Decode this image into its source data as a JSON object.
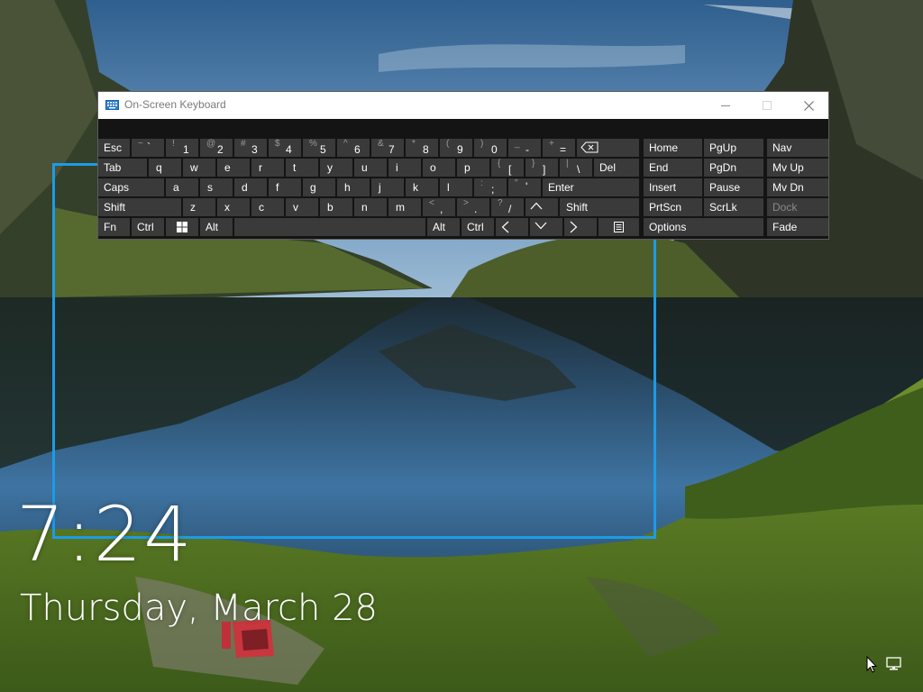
{
  "lock_screen": {
    "time": "7:24",
    "date": "Thursday, March 28"
  },
  "osk": {
    "title": "On-Screen Keyboard",
    "caption_buttons": [
      "minimize",
      "maximize",
      "close"
    ],
    "rows": [
      [
        {
          "id": "esc",
          "main": "Esc"
        },
        {
          "id": "tilde",
          "sub": "~",
          "low": "`"
        },
        {
          "id": "1",
          "sub": "!",
          "low": "1"
        },
        {
          "id": "2",
          "sub": "@",
          "low": "2"
        },
        {
          "id": "3",
          "sub": "#",
          "low": "3"
        },
        {
          "id": "4",
          "sub": "$",
          "low": "4"
        },
        {
          "id": "5",
          "sub": "%",
          "low": "5"
        },
        {
          "id": "6",
          "sub": "^",
          "low": "6"
        },
        {
          "id": "7",
          "sub": "&",
          "low": "7"
        },
        {
          "id": "8",
          "sub": "*",
          "low": "8"
        },
        {
          "id": "9",
          "sub": "(",
          "low": "9"
        },
        {
          "id": "0",
          "sub": ")",
          "low": "0"
        },
        {
          "id": "minus",
          "sub": "_",
          "low": "-"
        },
        {
          "id": "equals",
          "sub": "+",
          "low": "="
        },
        {
          "id": "backspace",
          "icon": "backspace-icon"
        }
      ],
      [
        {
          "id": "tab",
          "main": "Tab"
        },
        {
          "id": "q",
          "main": "q"
        },
        {
          "id": "w",
          "main": "w"
        },
        {
          "id": "e",
          "main": "e"
        },
        {
          "id": "r",
          "main": "r"
        },
        {
          "id": "t",
          "main": "t"
        },
        {
          "id": "y",
          "main": "y"
        },
        {
          "id": "u",
          "main": "u"
        },
        {
          "id": "i",
          "main": "i"
        },
        {
          "id": "o",
          "main": "o"
        },
        {
          "id": "p",
          "main": "p"
        },
        {
          "id": "lbracket",
          "sub": "{",
          "low": "["
        },
        {
          "id": "rbracket",
          "sub": "}",
          "low": "]"
        },
        {
          "id": "backslash",
          "sub": "|",
          "low": "\\"
        },
        {
          "id": "del",
          "main": "Del"
        }
      ],
      [
        {
          "id": "caps",
          "main": "Caps"
        },
        {
          "id": "a",
          "main": "a"
        },
        {
          "id": "s",
          "main": "s"
        },
        {
          "id": "d",
          "main": "d"
        },
        {
          "id": "f",
          "main": "f"
        },
        {
          "id": "g",
          "main": "g"
        },
        {
          "id": "h",
          "main": "h"
        },
        {
          "id": "j",
          "main": "j"
        },
        {
          "id": "k",
          "main": "k"
        },
        {
          "id": "l",
          "main": "l"
        },
        {
          "id": "semicolon",
          "sub": ":",
          "low": ";"
        },
        {
          "id": "quote",
          "sub": "\"",
          "low": "'"
        },
        {
          "id": "enter",
          "main": "Enter"
        }
      ],
      [
        {
          "id": "lshift",
          "main": "Shift"
        },
        {
          "id": "z",
          "main": "z"
        },
        {
          "id": "x",
          "main": "x"
        },
        {
          "id": "c",
          "main": "c"
        },
        {
          "id": "v",
          "main": "v"
        },
        {
          "id": "b",
          "main": "b"
        },
        {
          "id": "n",
          "main": "n"
        },
        {
          "id": "m",
          "main": "m"
        },
        {
          "id": "comma",
          "sub": "<",
          "low": ","
        },
        {
          "id": "period",
          "sub": ">",
          "low": "."
        },
        {
          "id": "slash",
          "sub": "?",
          "low": "/"
        },
        {
          "id": "up",
          "icon": "arrow-up-icon"
        },
        {
          "id": "rshift",
          "main": "Shift"
        }
      ],
      [
        {
          "id": "fn",
          "main": "Fn"
        },
        {
          "id": "lctrl",
          "main": "Ctrl"
        },
        {
          "id": "win",
          "icon": "windows-icon"
        },
        {
          "id": "lalt",
          "main": "Alt"
        },
        {
          "id": "space",
          "main": ""
        },
        {
          "id": "ralt",
          "main": "Alt"
        },
        {
          "id": "rctrl",
          "main": "Ctrl"
        },
        {
          "id": "left",
          "icon": "arrow-left-icon"
        },
        {
          "id": "down",
          "icon": "arrow-down-icon"
        },
        {
          "id": "right",
          "icon": "arrow-right-icon"
        },
        {
          "id": "menu",
          "icon": "context-menu-icon"
        }
      ]
    ],
    "nav_keys": [
      [
        {
          "id": "home",
          "main": "Home"
        },
        {
          "id": "pgup",
          "main": "PgUp"
        },
        {
          "id": "nav",
          "main": "Nav"
        }
      ],
      [
        {
          "id": "end",
          "main": "End"
        },
        {
          "id": "pgdn",
          "main": "PgDn"
        },
        {
          "id": "mvup",
          "main": "Mv Up"
        }
      ],
      [
        {
          "id": "insert",
          "main": "Insert"
        },
        {
          "id": "pause",
          "main": "Pause"
        },
        {
          "id": "mvdn",
          "main": "Mv Dn"
        }
      ],
      [
        {
          "id": "prtscn",
          "main": "PrtScn"
        },
        {
          "id": "scrlk",
          "main": "ScrLk"
        },
        {
          "id": "dock",
          "main": "Dock",
          "disabled": true
        }
      ],
      [
        {
          "id": "options",
          "main": "Options"
        },
        {
          "id": "fade",
          "main": "Fade"
        }
      ]
    ]
  },
  "colors": {
    "focus_rect": "#1d9be6",
    "key_bg": "#3a3a3a",
    "osk_bg": "#141414",
    "sub_label": "#9a9a9a"
  }
}
